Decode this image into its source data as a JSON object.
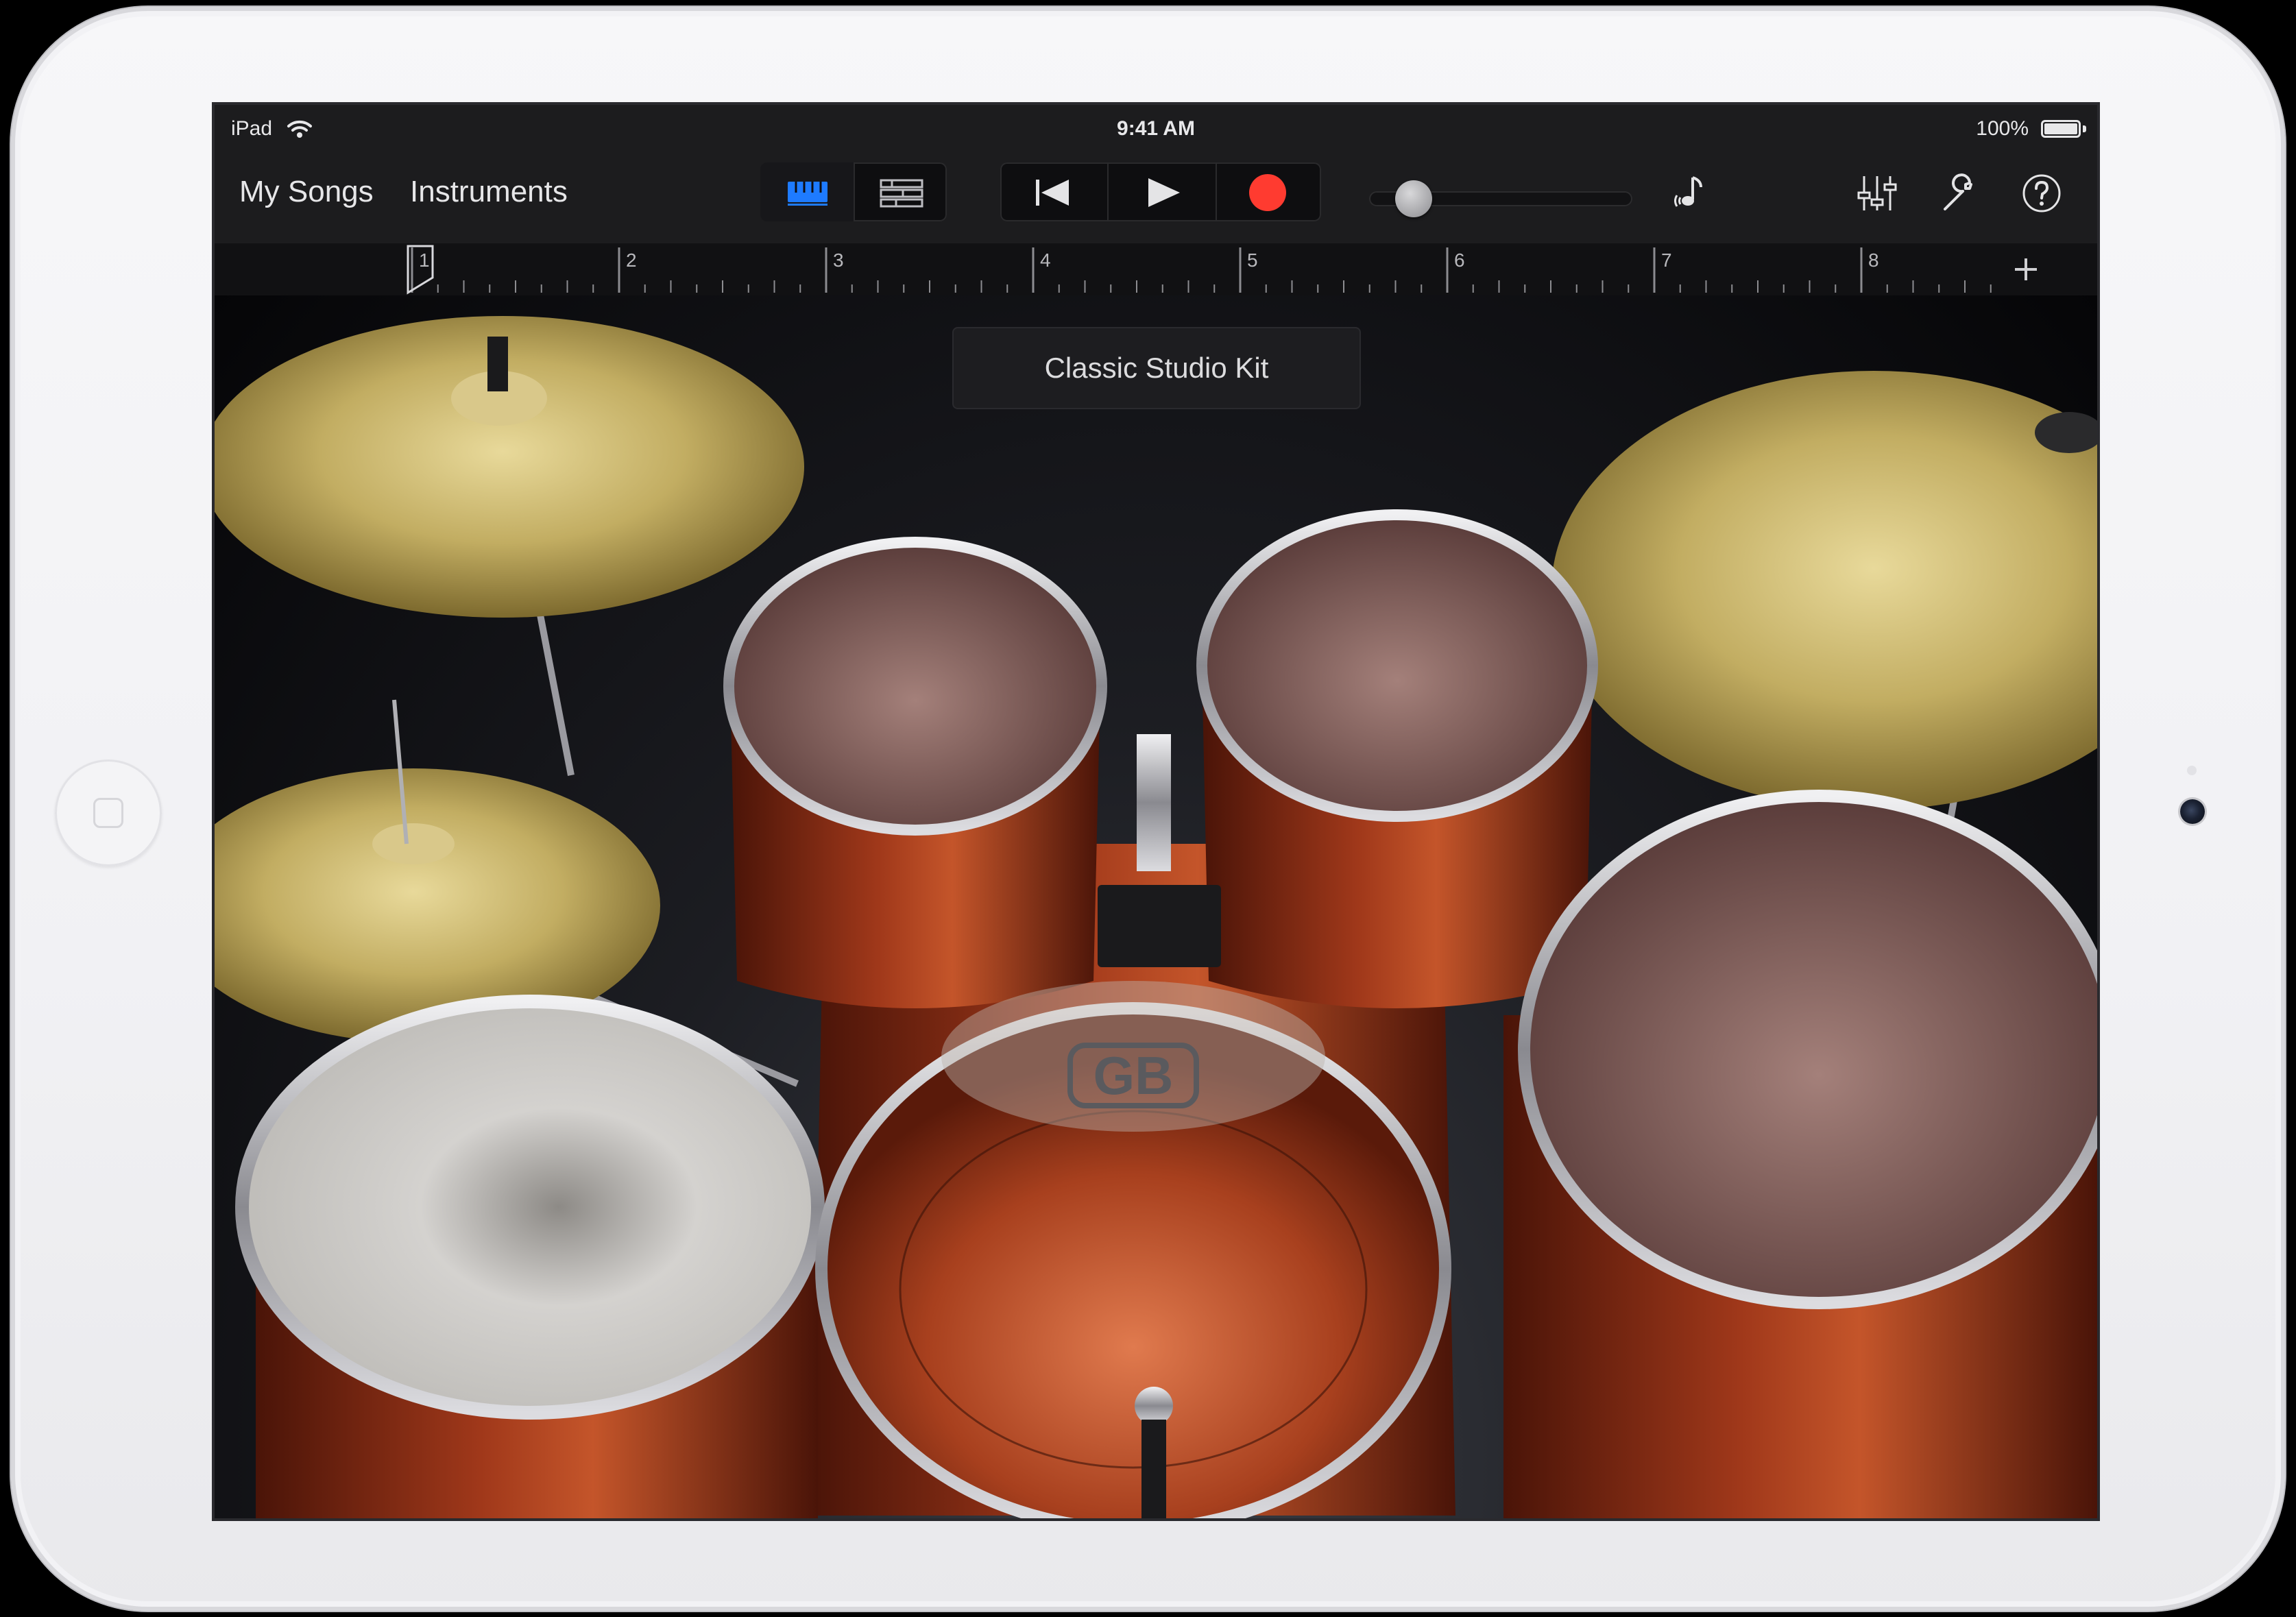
{
  "status_bar": {
    "device": "iPad",
    "time": "9:41 AM",
    "battery": "100%"
  },
  "toolbar": {
    "my_songs": "My Songs",
    "instruments": "Instruments",
    "view_buttons": [
      "tracks-view-icon",
      "list-view-icon"
    ],
    "transport": [
      "rewind-icon",
      "play-icon",
      "record-icon"
    ],
    "volume_level": 0.17,
    "tools": [
      "metronome-icon",
      "mixer-icon",
      "wrench-icon",
      "help-icon"
    ]
  },
  "ruler": {
    "bars": [
      "1",
      "2",
      "3",
      "4",
      "5",
      "6",
      "7",
      "8"
    ],
    "add_icon": "plus-icon"
  },
  "instrument": {
    "kit_name": "Classic Studio Kit",
    "logo_text": "GB"
  },
  "colors": {
    "accent_blue": "#1e7bff",
    "record_red": "#ff3b30",
    "cymbal_gold": "#c9b56a",
    "drum_wood": "#8a2a14"
  }
}
